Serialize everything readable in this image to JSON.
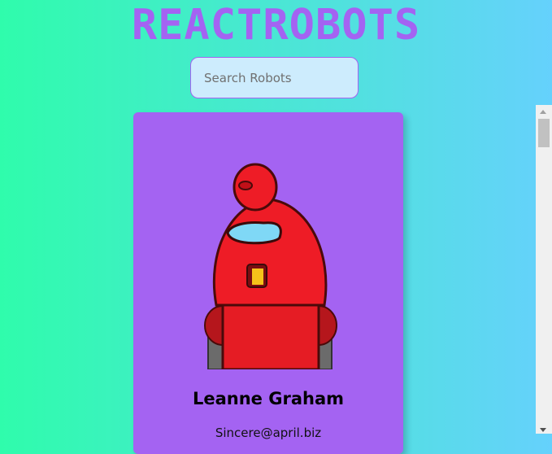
{
  "header": {
    "title": "REACTROBOTS"
  },
  "search": {
    "placeholder": "Search Robots",
    "value": ""
  },
  "cards": [
    {
      "name": "Leanne Graham",
      "email": "Sincere@april.biz",
      "image_icon": "red-robot-illustration"
    }
  ],
  "colors": {
    "accent": "#a463f2",
    "gradient_start": "#2ffcac",
    "gradient_end": "#65d1fc"
  }
}
